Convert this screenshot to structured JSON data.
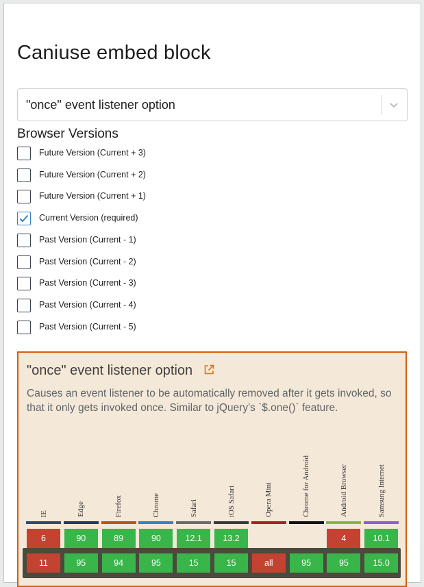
{
  "page": {
    "title": "Caniuse embed block"
  },
  "feature_select": {
    "value": "\"once\" event listener option",
    "chevron_icon": "chevron-down-icon"
  },
  "browser_versions": {
    "label": "Browser Versions",
    "options": [
      {
        "label": "Future Version (Current + 3)",
        "checked": false
      },
      {
        "label": "Future Version (Current + 2)",
        "checked": false
      },
      {
        "label": "Future Version (Current + 1)",
        "checked": false
      },
      {
        "label": "Current Version (required)",
        "checked": true
      },
      {
        "label": "Past Version (Current - 1)",
        "checked": false
      },
      {
        "label": "Past Version (Current - 2)",
        "checked": false
      },
      {
        "label": "Past Version (Current - 3)",
        "checked": false
      },
      {
        "label": "Past Version (Current - 4)",
        "checked": false
      },
      {
        "label": "Past Version (Current - 5)",
        "checked": false
      }
    ]
  },
  "embed": {
    "title": "\"once\" event listener option",
    "link_icon": "external-link-icon",
    "description": "Causes an event listener to be automatically removed after it gets invoked, so that it only gets invoked once. Similar to jQuery's `$.one()` feature.",
    "browsers": [
      {
        "name": "IE",
        "color": "#2a4c6e",
        "prev": "6",
        "prev_status": "no",
        "current": "11",
        "current_status": "no"
      },
      {
        "name": "Edge",
        "color": "#1f3c64",
        "prev": "90",
        "prev_status": "yes",
        "current": "95",
        "current_status": "yes"
      },
      {
        "name": "Firefox",
        "color": "#b3581b",
        "prev": "89",
        "prev_status": "yes",
        "current": "94",
        "current_status": "yes"
      },
      {
        "name": "Chrome",
        "color": "#3b7fc4",
        "prev": "90",
        "prev_status": "yes",
        "current": "95",
        "current_status": "yes"
      },
      {
        "name": "Safari",
        "color": "#6b6b6b",
        "prev": "12.1",
        "prev_status": "yes",
        "current": "15",
        "current_status": "yes"
      },
      {
        "name": "iOS Safari",
        "color": "#3a3a3a",
        "prev": "13.2",
        "prev_status": "yes",
        "current": "15",
        "current_status": "yes"
      },
      {
        "name": "Opera Mini",
        "color": "#a52222",
        "prev": "",
        "prev_status": "none",
        "current": "all",
        "current_status": "no"
      },
      {
        "name": "Chrome for Android",
        "color": "#111111",
        "prev": "",
        "prev_status": "none",
        "current": "95",
        "current_status": "yes"
      },
      {
        "name": "Android Browser",
        "color": "#8bb443",
        "prev": "4",
        "prev_status": "no",
        "current": "95",
        "current_status": "yes"
      },
      {
        "name": "Samsung Internet",
        "color": "#8b5fd6",
        "prev": "10.1",
        "prev_status": "yes",
        "current": "15.0",
        "current_status": "yes"
      }
    ],
    "colors": {
      "yes": "#39b54a",
      "no": "#c44230",
      "border": "#d35f11",
      "background": "#f4e8d8"
    }
  }
}
